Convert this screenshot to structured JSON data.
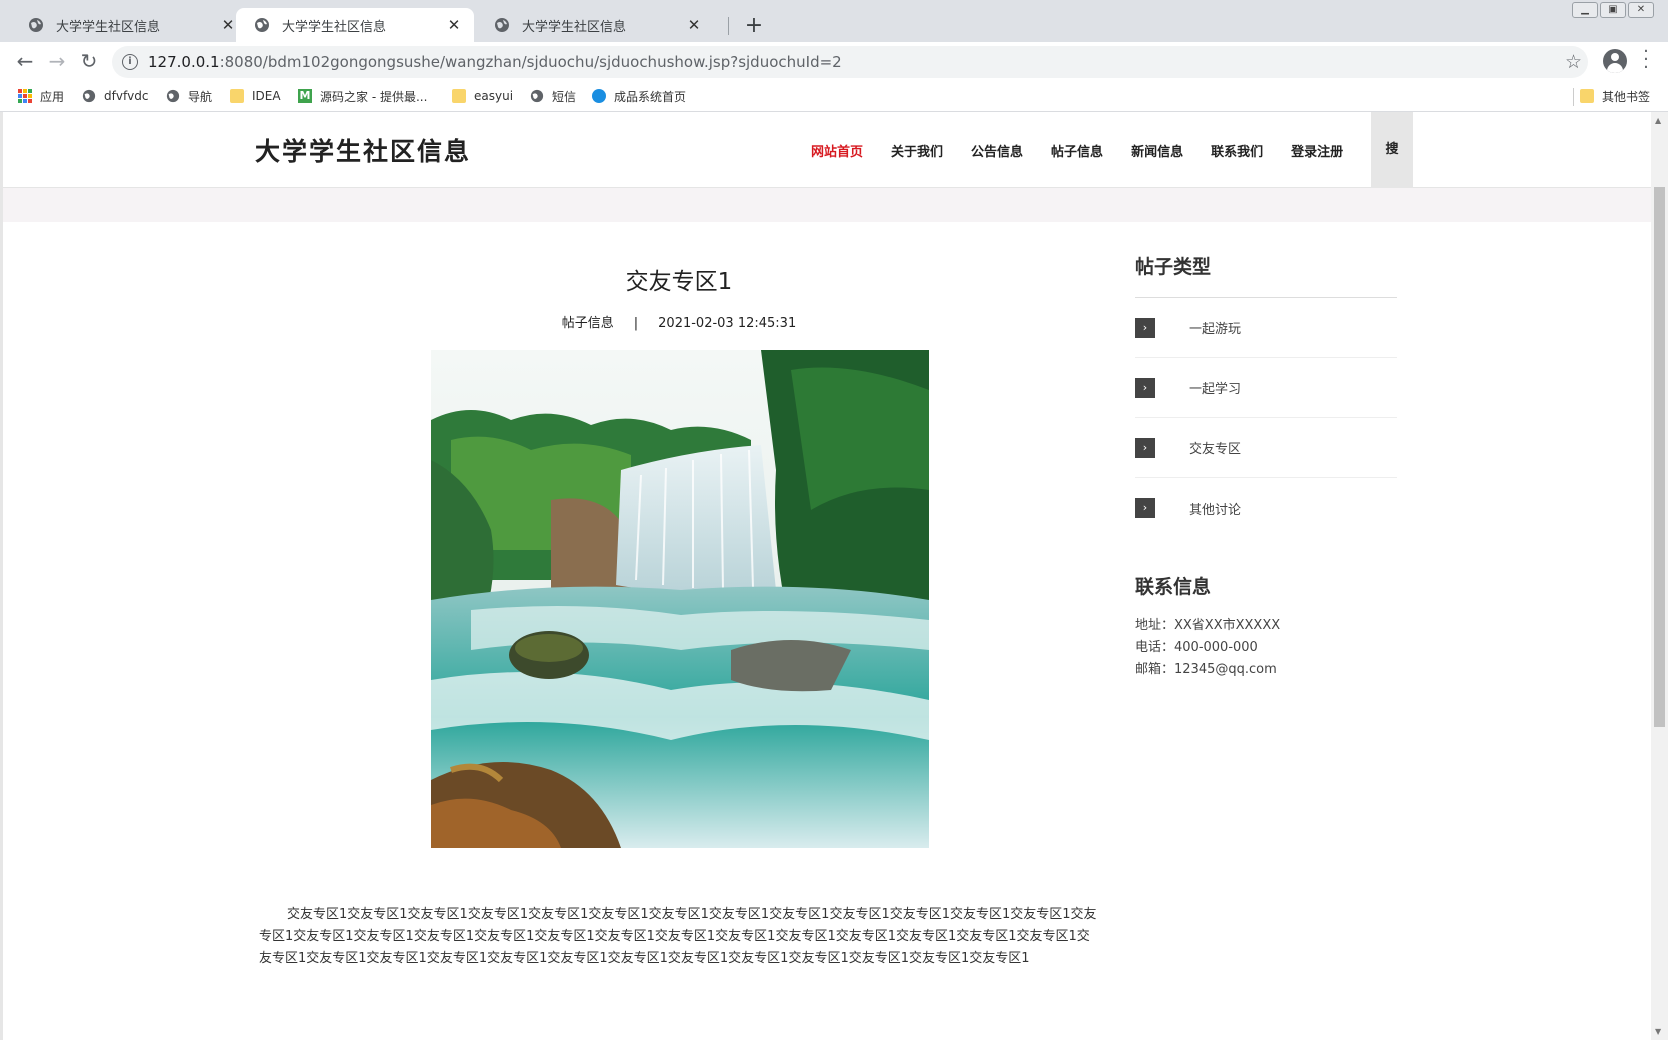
{
  "browser": {
    "tabs": [
      {
        "title": "大学学生社区信息",
        "active": false
      },
      {
        "title": "大学学生社区信息",
        "active": true
      },
      {
        "title": "大学学生社区信息",
        "active": false
      }
    ],
    "new_tab": "+",
    "url_host": "127.0.0.1",
    "url_path": ":8080/bdm102gongongsushe/wangzhan/sjduochu/sjduochushow.jsp?sjduochuId=2",
    "bookmarks": [
      {
        "label": "应用",
        "icon": "apps-icon"
      },
      {
        "label": "dfvfvdc",
        "icon": "globe-icon"
      },
      {
        "label": "导航",
        "icon": "globe-icon"
      },
      {
        "label": "IDEA",
        "icon": "folder-icon"
      },
      {
        "label": "源码之家 - 提供最...",
        "icon": "m-icon"
      },
      {
        "label": "easyui",
        "icon": "folder-icon"
      },
      {
        "label": "短信",
        "icon": "globe-icon"
      },
      {
        "label": "成品系统首页",
        "icon": "blue-circle-icon"
      }
    ],
    "other_bookmarks": "其他书签"
  },
  "site": {
    "logo": "大学学生社区信息",
    "nav": [
      {
        "label": "网站首页",
        "active": true
      },
      {
        "label": "关于我们",
        "active": false
      },
      {
        "label": "公告信息",
        "active": false
      },
      {
        "label": "帖子信息",
        "active": false
      },
      {
        "label": "新闻信息",
        "active": false
      },
      {
        "label": "联系我们",
        "active": false
      },
      {
        "label": "登录注册",
        "active": false
      }
    ],
    "search": "搜",
    "accent_color": "#d71920"
  },
  "article": {
    "title": "交友专区1",
    "category": "帖子信息",
    "separator": "|",
    "date": "2021-02-03 12:45:31",
    "image": "waterfall-photo",
    "body": "交友专区1交友专区1交友专区1交友专区1交友专区1交友专区1交友专区1交友专区1交友专区1交友专区1交友专区1交友专区1交友专区1交友专区1交友专区1交友专区1交友专区1交友专区1交友专区1交友专区1交友专区1交友专区1交友专区1交友专区1交友专区1交友专区1交友专区1交友专区1交友专区1交友专区1交友专区1交友专区1交友专区1交友专区1交友专区1交友专区1交友专区1交友专区1交友专区1交友专区1"
  },
  "sidebar": {
    "categories_heading": "帖子类型",
    "categories": [
      "一起游玩",
      "一起学习",
      "交友专区",
      "其他讨论"
    ],
    "contact_heading": "联系信息",
    "contact": [
      "地址：XX省XX市XXXXX",
      "电话：400-000-000",
      "邮箱：12345@qq.com"
    ]
  }
}
